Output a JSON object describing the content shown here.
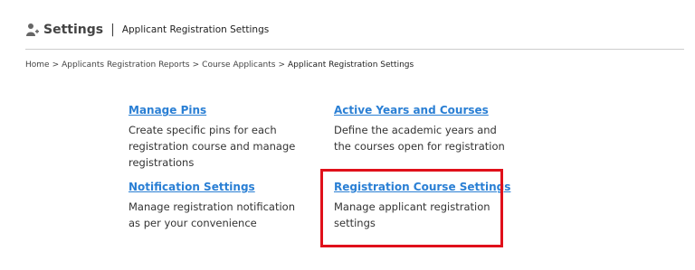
{
  "header": {
    "title": "Settings",
    "separator": "|",
    "subtitle": "Applicant Registration Settings",
    "icon": "user-add-icon"
  },
  "breadcrumb": {
    "items": [
      "Home",
      "Applicants Registration Reports",
      "Course Applicants"
    ],
    "separator": ">",
    "current": "Applicant Registration Settings"
  },
  "cards": [
    {
      "title": "Manage Pins",
      "description": "Create specific pins for each registration course and manage registrations"
    },
    {
      "title": "Active Years and Courses",
      "description": "Define the academic years and the courses open for registration"
    },
    {
      "title": "Notification Settings",
      "description": "Manage registration notification as per your convenience"
    },
    {
      "title": "Registration Course Settings",
      "description": "Manage applicant registration settings"
    }
  ],
  "colors": {
    "link": "#2a7fd4",
    "highlight": "#e0101a"
  }
}
